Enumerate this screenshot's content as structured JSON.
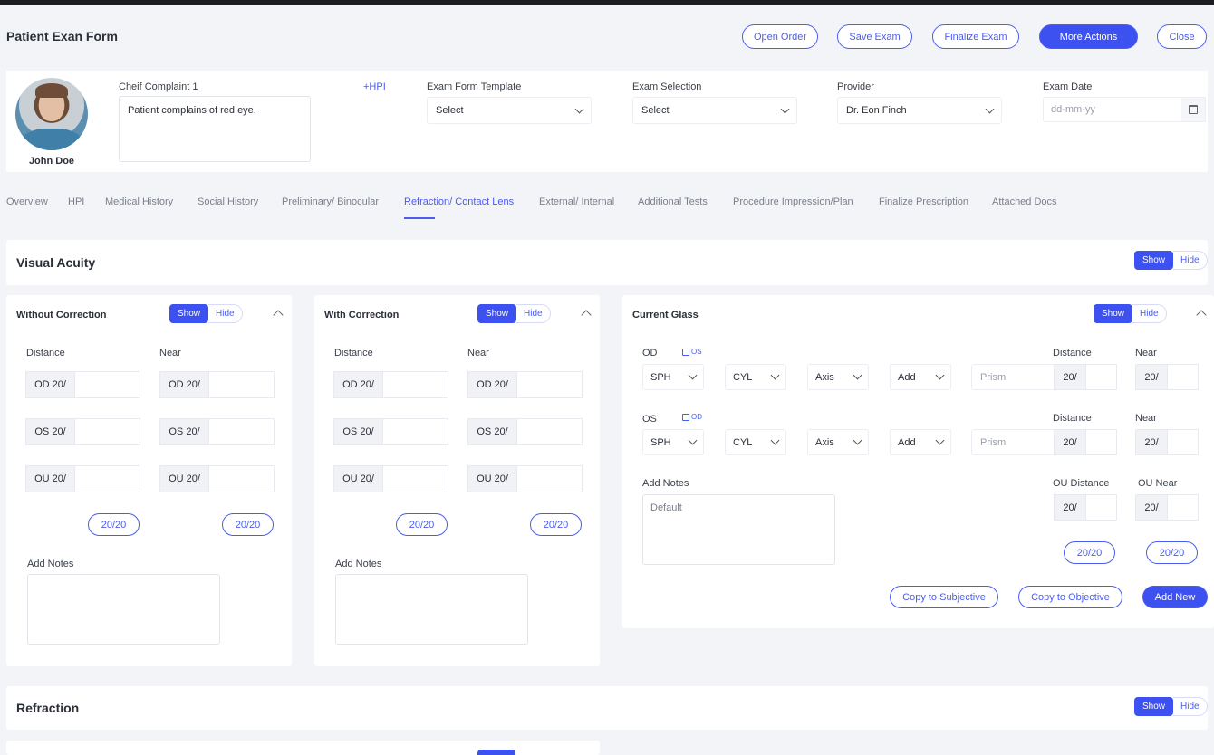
{
  "header": {
    "title": "Patient Exan Form",
    "buttons": {
      "open_order": "Open Order",
      "save_exam": "Save Exam",
      "finalize_exam": "Finalize Exam",
      "more_actions": "More Actions",
      "close": "Close"
    }
  },
  "patient": {
    "name": "John Doe",
    "chief_complaint_label": "Cheif Complaint 1",
    "chief_complaint_value": "Patient complains of red eye.",
    "hpi_link": "+HPI",
    "exam_form_template": {
      "label": "Exam Form Template",
      "value": "Select"
    },
    "exam_selection": {
      "label": "Exam Selection",
      "value": "Select"
    },
    "provider": {
      "label": "Provider",
      "value": "Dr. Eon Finch"
    },
    "exam_date": {
      "label": "Exam Date",
      "placeholder": "dd-mm-yy"
    }
  },
  "tabs": [
    "Overview",
    "HPI",
    "Medical History",
    "Social History",
    "Preliminary/ Binocular",
    "Refraction/ Contact Lens",
    "External/ Internal",
    "Additional Tests",
    "Procedure Impression/Plan",
    "Finalize Prescription",
    "Attached Docs"
  ],
  "active_tab": "Refraction/ Contact Lens",
  "toggle": {
    "show": "Show",
    "hide": "Hide"
  },
  "visual_acuity": {
    "title": "Visual Acuity",
    "without_correction": {
      "title": "Without Correction",
      "distance_label": "Distance",
      "near_label": "Near",
      "rows": [
        "OD 20/",
        "OS 20/",
        "OU 20/"
      ],
      "button": "20/20",
      "notes_label": "Add Notes"
    },
    "with_correction": {
      "title": "With Correction",
      "distance_label": "Distance",
      "near_label": "Near",
      "rows": [
        "OD 20/",
        "OS 20/",
        "OU 20/"
      ],
      "button": "20/20",
      "notes_label": "Add Notes"
    },
    "current_glass": {
      "title": "Current Glass",
      "od_label": "OD",
      "od_copy": "OS",
      "os_label": "OS",
      "os_copy": "OD",
      "selects": [
        "SPH",
        "CYL",
        "Axis",
        "Add"
      ],
      "prism_placeholder": "Prism",
      "distance_label": "Distance",
      "near_label": "Near",
      "small_prefix": "20/",
      "ou_distance_label": "OU Distance",
      "ou_near_label": "OU Near",
      "notes_label": "Add Notes",
      "notes_value": "Default",
      "button": "20/20",
      "copy_subjective": "Copy to Subjective",
      "copy_objective": "Copy to Objective",
      "add_new": "Add New"
    }
  },
  "refraction": {
    "title": "Refraction"
  }
}
